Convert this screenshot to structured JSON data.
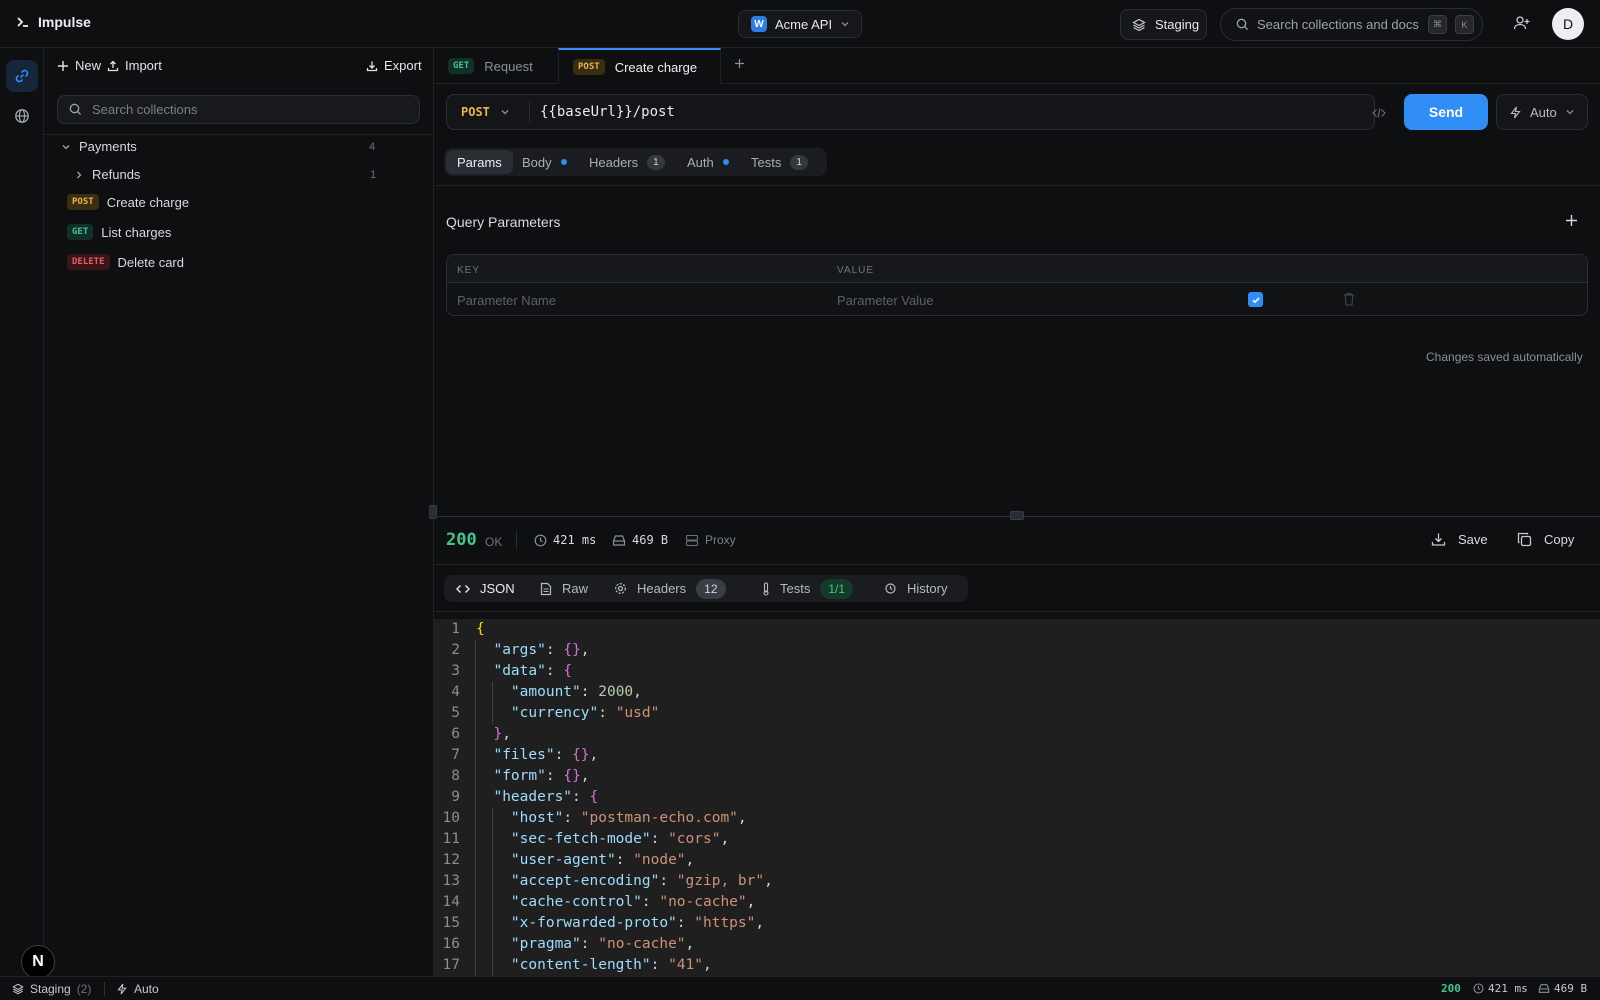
{
  "app": {
    "name": "Impulse"
  },
  "workspace": {
    "badge": "W",
    "name": "Acme API"
  },
  "environment": {
    "name": "Staging"
  },
  "global_search": {
    "placeholder": "Search collections and docs",
    "kbd_mod": "⌘",
    "kbd_key": "K"
  },
  "user": {
    "initial": "D"
  },
  "sidebar": {
    "new_label": "New",
    "import_label": "Import",
    "export_label": "Export",
    "search_placeholder": "Search collections",
    "folders": [
      {
        "name": "Payments",
        "count": "4"
      },
      {
        "name": "Refunds",
        "count": "1"
      }
    ],
    "requests": [
      {
        "method": "POST",
        "name": "Create charge"
      },
      {
        "method": "GET",
        "name": "List charges"
      },
      {
        "method": "DELETE",
        "name": "Delete card"
      }
    ]
  },
  "tabs": [
    {
      "method": "GET",
      "label": "Request",
      "active": false
    },
    {
      "method": "POST",
      "label": "Create charge",
      "active": true
    }
  ],
  "request": {
    "method": "POST",
    "url": "{{baseUrl}}/post",
    "send_label": "Send",
    "mode_label": "Auto"
  },
  "request_tabs": [
    {
      "label": "Params",
      "active": true
    },
    {
      "label": "Body",
      "dot": true
    },
    {
      "label": "Headers",
      "count": "1"
    },
    {
      "label": "Auth",
      "dot": true
    },
    {
      "label": "Tests",
      "count": "1"
    }
  ],
  "params": {
    "title": "Query Parameters",
    "col_key": "KEY",
    "col_value": "VALUE",
    "key_placeholder": "Parameter Name",
    "value_placeholder": "Parameter Value",
    "enabled": true,
    "saved_note": "Changes saved automatically"
  },
  "response": {
    "status_code": "200",
    "status_text": "OK",
    "time": "421 ms",
    "size": "469 B",
    "proxy_label": "Proxy",
    "save_label": "Save",
    "copy_label": "Copy",
    "tabs": [
      {
        "label": "JSON",
        "active": true
      },
      {
        "label": "Raw"
      },
      {
        "label": "Headers",
        "count": "12"
      },
      {
        "label": "Tests",
        "count": "1/1"
      },
      {
        "label": "History"
      }
    ],
    "body_lines": [
      "{",
      "  \"args\": {},",
      "  \"data\": {",
      "    \"amount\": 2000,",
      "    \"currency\": \"usd\"",
      "  },",
      "  \"files\": {},",
      "  \"form\": {},",
      "  \"headers\": {",
      "    \"host\": \"postman-echo.com\",",
      "    \"sec-fetch-mode\": \"cors\",",
      "    \"user-agent\": \"node\",",
      "    \"accept-encoding\": \"gzip, br\",",
      "    \"cache-control\": \"no-cache\",",
      "    \"x-forwarded-proto\": \"https\",",
      "    \"pragma\": \"no-cache\",",
      "    \"content-length\": \"41\","
    ]
  },
  "statusbar": {
    "env_name": "Staging",
    "env_count": "(2)",
    "mode": "Auto",
    "status_code": "200",
    "time": "421 ms",
    "size": "469 B"
  },
  "colors": {
    "accent": "#2f8df5",
    "success": "#46c48d",
    "post": "#e7b64a",
    "get": "#46c48d",
    "delete": "#ea5c63"
  },
  "icons": [
    "terminal-icon",
    "chevron-down-icon",
    "layers-icon",
    "search-icon",
    "add-user-icon",
    "link-icon",
    "globe-icon",
    "plus-icon",
    "upload-icon",
    "download-icon",
    "chevron-right-icon",
    "code-icon",
    "lightning-icon",
    "check-icon",
    "trash-icon",
    "clock-icon",
    "drive-icon",
    "server-icon",
    "copy-icon",
    "file-icon",
    "gear-icon",
    "thermometer-icon",
    "history-icon"
  ]
}
